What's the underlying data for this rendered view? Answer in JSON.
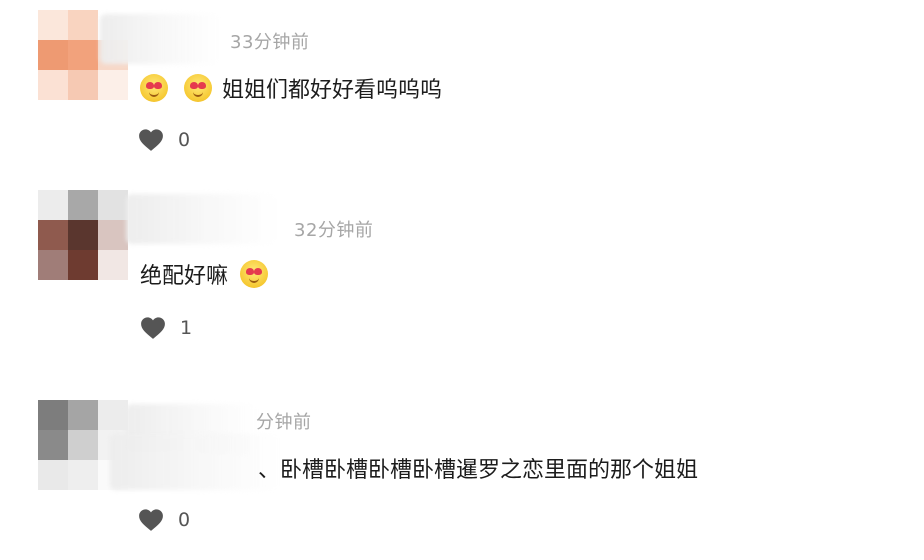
{
  "comments": [
    {
      "time": "33分钟前",
      "text": "姐姐们都好好看呜呜呜",
      "likes": "0",
      "emoji_count": 2,
      "icons": [
        "heart-eyes-emoji-icon",
        "heart-icon"
      ]
    },
    {
      "time": "32分钟前",
      "text": "绝配好嘛",
      "likes": "1",
      "emoji_count": 1,
      "icons": [
        "heart-eyes-emoji-icon",
        "heart-icon"
      ]
    },
    {
      "time": "分钟前",
      "text": "、卧槽卧槽卧槽卧槽暹罗之恋里面的那个姐姐",
      "likes": "0",
      "emoji_count": 0,
      "icons": [
        "heart-icon"
      ]
    }
  ],
  "colors": {
    "time_gray": "#a6a6a6",
    "heart_gray": "#555555",
    "emoji_yellow": "#f6c933"
  }
}
